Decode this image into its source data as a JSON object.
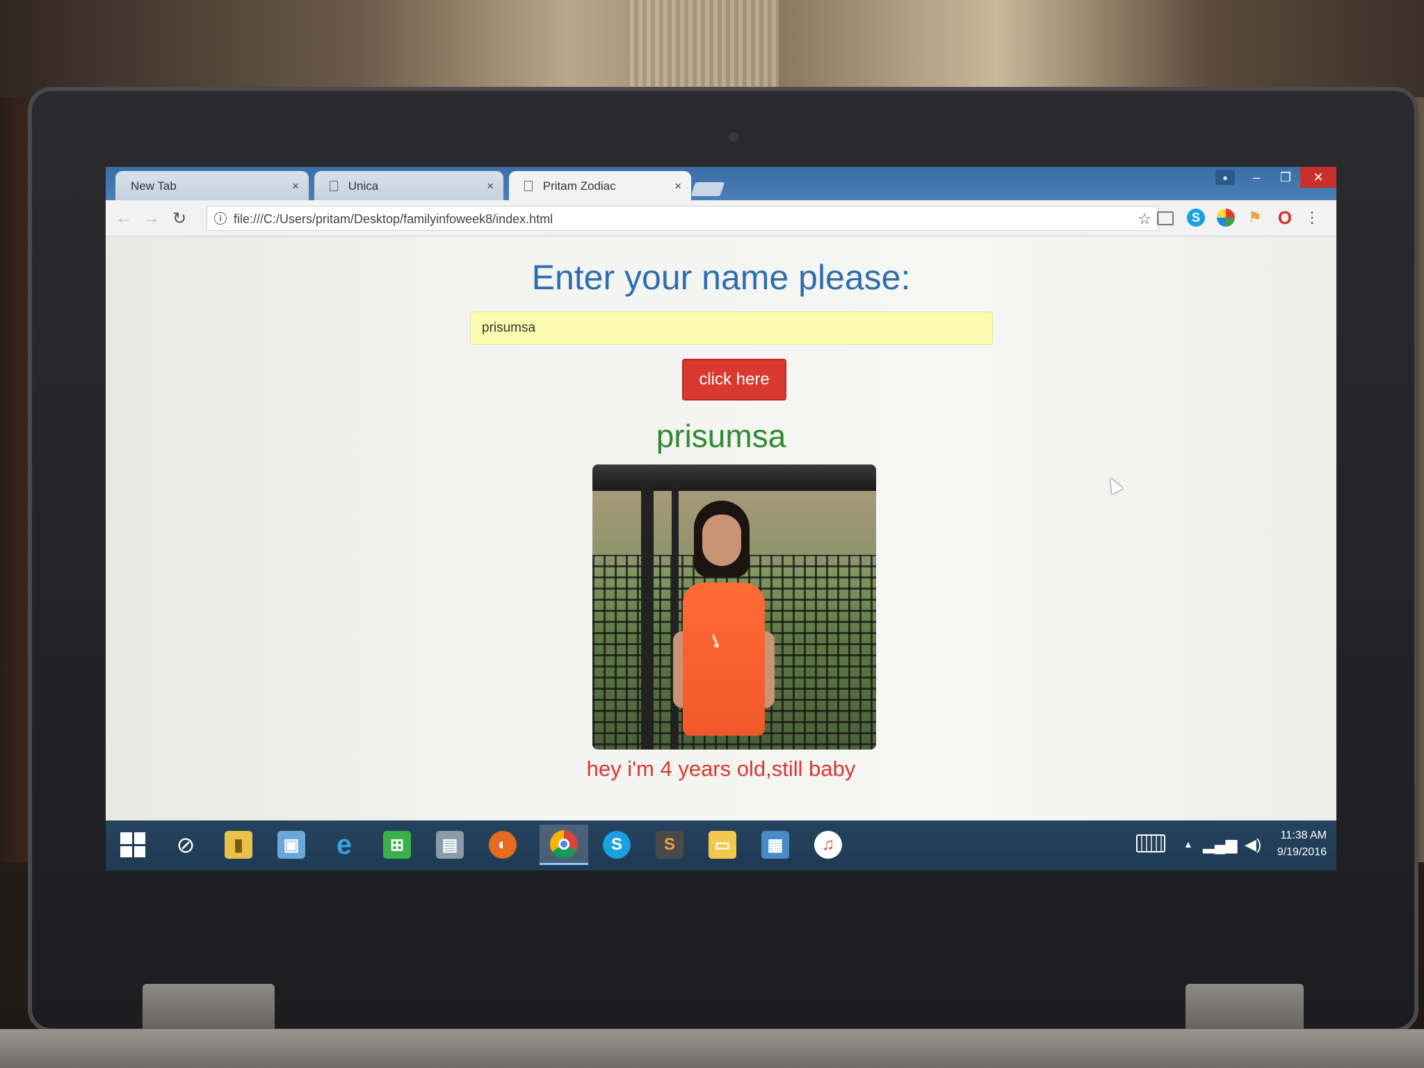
{
  "browser": {
    "tabs": [
      {
        "label": "New Tab",
        "close": "×"
      },
      {
        "label": "Unica",
        "close": "×"
      },
      {
        "label": "Pritam Zodiac",
        "close": "×"
      }
    ],
    "url": "file:///C:/Users/pritam/Desktop/familyinfoweek8/index.html",
    "window_controls": {
      "minimize": "–",
      "restore": "❐",
      "close": "✕"
    }
  },
  "page": {
    "heading": "Enter your name please:",
    "name_input_value": "prisumsa",
    "button_label": "click here",
    "greeting_name": "prisumsa",
    "caption": "hey i'm 4 years old,still baby"
  },
  "taskbar": {
    "clock_time": "11:38 AM",
    "clock_date": "9/19/2016",
    "apps": [
      "start-icon",
      "cortana-icon",
      "file-explorer-icon",
      "control-panel-icon",
      "internet-explorer-icon",
      "store-icon",
      "task-view-icon",
      "firefox-icon",
      "chrome-icon",
      "skype-icon",
      "sublime-text-icon",
      "folder-icon",
      "photos-icon",
      "itunes-icon"
    ]
  },
  "colors": {
    "heading": "#2f6ead",
    "input_bg": "#fbfbb0",
    "button_bg": "#d9392e",
    "greeting": "#2f8a2f",
    "caption": "#d9392e",
    "titlebar": "#3a6ea5",
    "taskbar": "#1e3a54"
  }
}
